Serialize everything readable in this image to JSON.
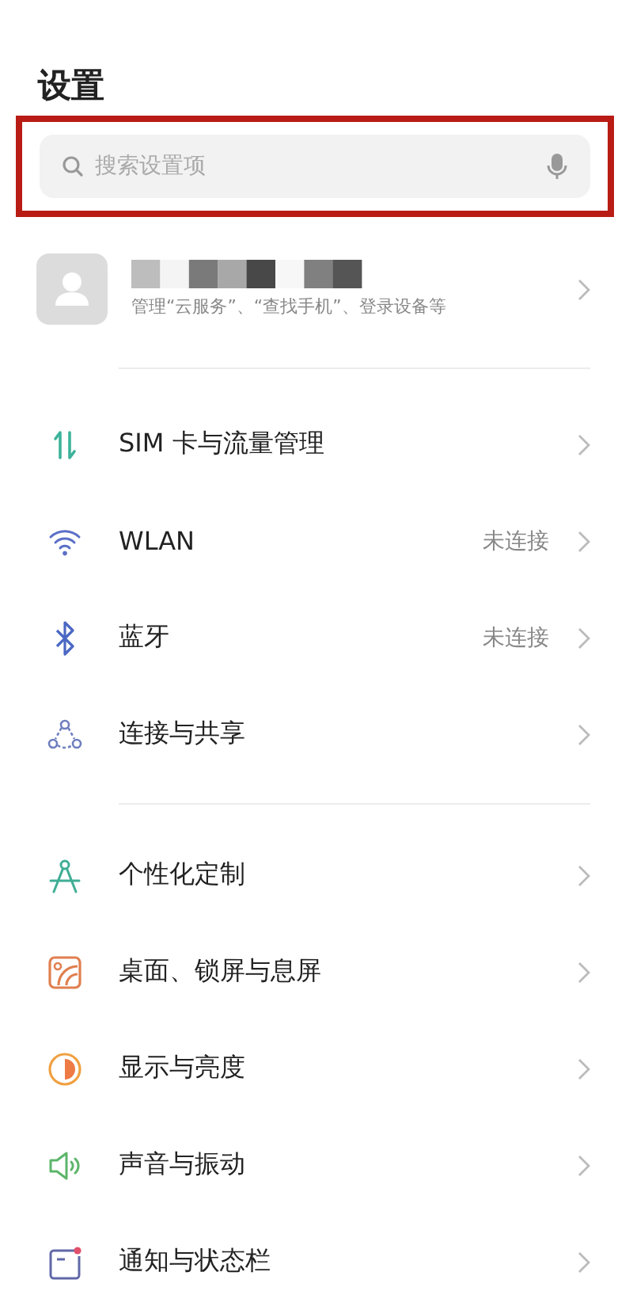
{
  "title": "设置",
  "search": {
    "placeholder": "搜索设置项",
    "highlighted": true
  },
  "account": {
    "subtitle": "管理“云服务”、“查找手机”、登录设备等"
  },
  "sections": [
    {
      "items": [
        {
          "label": "SIM 卡与流量管理"
        },
        {
          "label": "WLAN",
          "value": "未连接"
        },
        {
          "label": "蓝牙",
          "value": "未连接"
        },
        {
          "label": "连接与共享"
        }
      ]
    },
    {
      "items": [
        {
          "label": "个性化定制"
        },
        {
          "label": "桌面、锁屏与息屏"
        },
        {
          "label": "显示与亮度"
        },
        {
          "label": "声音与振动"
        },
        {
          "label": "通知与状态栏"
        }
      ]
    }
  ]
}
